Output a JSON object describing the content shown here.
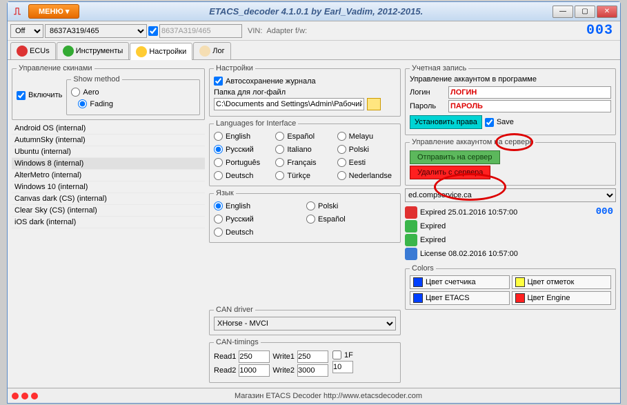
{
  "title": "ETACS_decoder 4.1.0.1 by Earl_Vadim, 2012-2015.",
  "menu_label": "МЕНЮ",
  "toolbar": {
    "off": "Off",
    "device": "8637A319/465",
    "device_gray": "8637A319/465",
    "vin_label": "VIN:",
    "adapter_label": "Adapter f/w:",
    "counter": "003"
  },
  "tabs": {
    "ecus": "ECUs",
    "instr": "Инструменты",
    "settings": "Настройки",
    "log": "Лог"
  },
  "skins": {
    "legend": "Управление скинами",
    "enable": "Включить",
    "show_legend": "Show method",
    "aero": "Aero",
    "fading": "Fading",
    "list": [
      "Android OS (internal)",
      "AutumnSky (internal)",
      "Ubuntu (internal)",
      "Windows 8 (internal)",
      "AlterMetro (internal)",
      "Windows 10 (internal)",
      "Canvas dark (CS) (internal)",
      "Clear Sky (CS) (internal)",
      "iOS dark (internal)"
    ],
    "selected": 3
  },
  "settings": {
    "legend": "Настройки",
    "autosave": "Автосохранение журнала",
    "log_folder_label": "Папка для лог-файл",
    "log_folder": "C:\\Documents and Settings\\Admin\\Рабочий стс",
    "lang_iface_legend": "Languages for Interface",
    "lang_iface": [
      "English",
      "Español",
      "Melayu",
      "Русский",
      "Italiano",
      "Polski",
      "Português",
      "Français",
      "Eesti",
      "Deutsch",
      "Türkçe",
      "Nederlandse"
    ],
    "lang_legend": "Язык",
    "lang": [
      "English",
      "Polski",
      "Русский",
      "Español",
      "Deutsch"
    ],
    "can_driver_legend": "CAN driver",
    "can_driver": "XHorse - MVCI",
    "can_timings_legend": "CAN-timings",
    "read1_lbl": "Read1",
    "read1": "250",
    "write1_lbl": "Write1",
    "write1": "250",
    "read2_lbl": "Read2",
    "read2": "1000",
    "write2_lbl": "Write2",
    "write2": "3000",
    "one_f": "1F",
    "ten": "10"
  },
  "account": {
    "legend": "Учетная запись",
    "prog_legend": "Управление аккаунтом в программе",
    "login_lbl": "Логин",
    "login": "ЛОГИН",
    "pass_lbl": "Пароль",
    "pass": "ПАРОЛЬ",
    "set_rights": "Установить права",
    "save": "Save",
    "server_legend": "Управление аккаунтом на сервере",
    "send": "Отправить на сервер",
    "delete": "Удалить с сервера",
    "server": "ed.compservice.ca",
    "statuses": [
      {
        "c": "r-red",
        "t": "Expired 25.01.2016 10:57:00"
      },
      {
        "c": "r-green",
        "t": "Expired"
      },
      {
        "c": "r-green",
        "t": "Expired"
      },
      {
        "c": "r-blue",
        "t": "License 08.02.2016 10:57:00"
      }
    ],
    "digits": "000",
    "colors_legend": "Colors",
    "col": {
      "counter": "Цвет счетчика",
      "marks": "Цвет отметок",
      "etacs": "Цвет ETACS",
      "engine": "Цвет Engine"
    }
  },
  "statusbar": "Магазин ETACS Decoder http://www.etacsdecoder.com"
}
